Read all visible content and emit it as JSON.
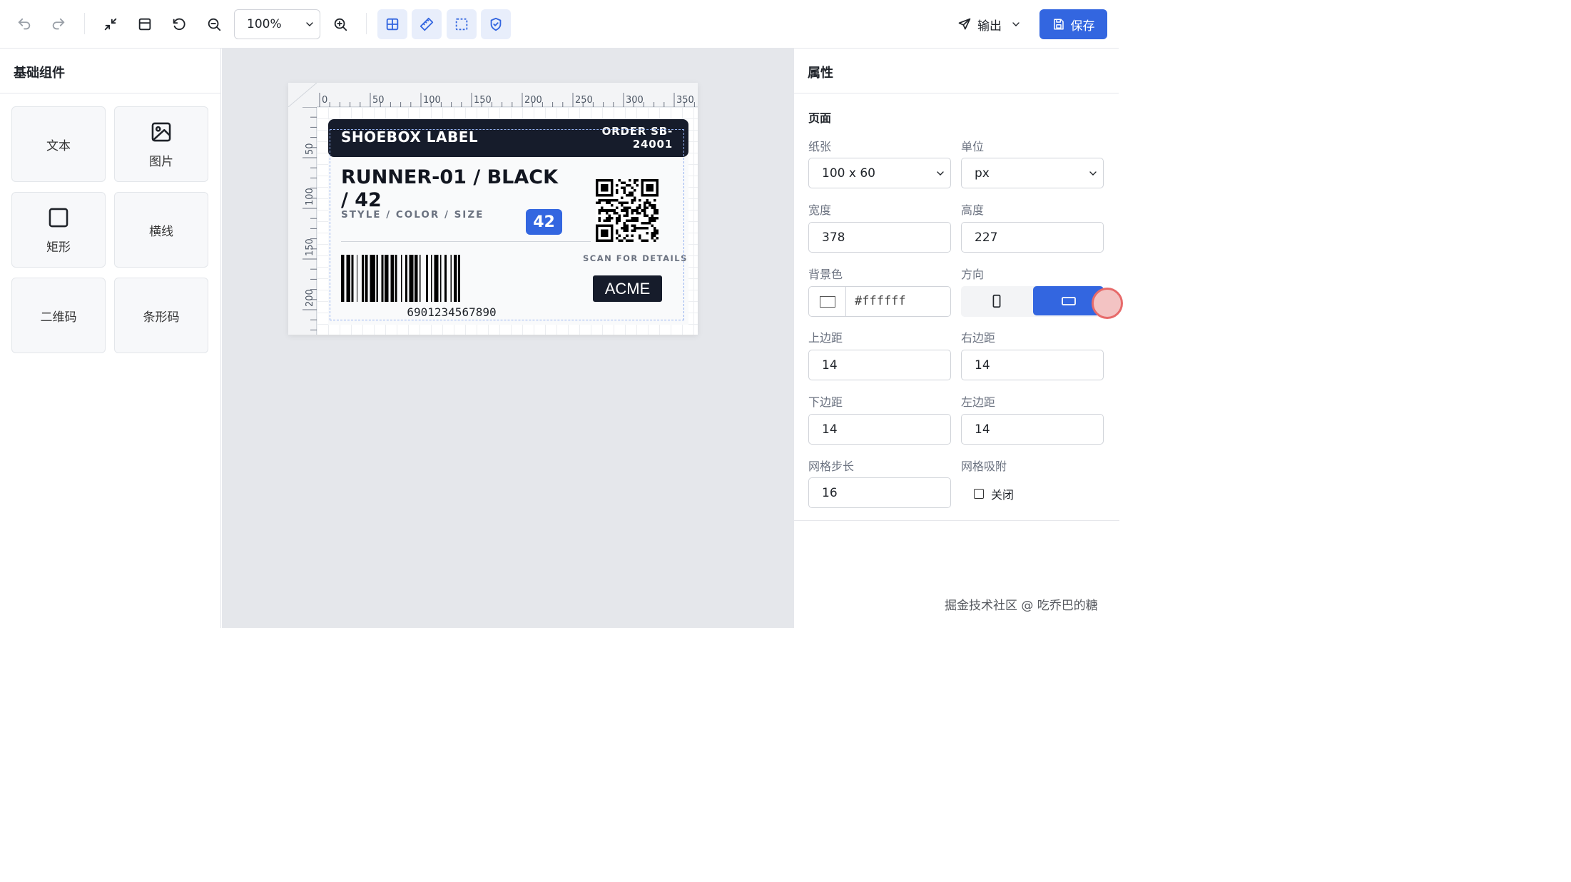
{
  "toolbar": {
    "zoom_value": "100%",
    "export_label": "输出",
    "save_label": "保存"
  },
  "left_panel": {
    "title": "基础组件",
    "components": [
      {
        "label": "文本",
        "icon": "text-icon"
      },
      {
        "label": "图片",
        "icon": "image-icon"
      },
      {
        "label": "矩形",
        "icon": "rectangle-icon"
      },
      {
        "label": "横线",
        "icon": "line-icon"
      },
      {
        "label": "二维码",
        "icon": "qrcode-icon"
      },
      {
        "label": "条形码",
        "icon": "barcode-icon"
      }
    ]
  },
  "ruler": {
    "top_labels": [
      "0",
      "50",
      "100",
      "150",
      "200",
      "250",
      "300",
      "350"
    ],
    "left_labels": [
      "50",
      "100",
      "150",
      "200"
    ]
  },
  "label": {
    "title": "SHOEBOX LABEL",
    "order_line1": "ORDER SB-",
    "order_line2": "24001",
    "product": "RUNNER-01 / BLACK / 42",
    "style_caption": "STYLE / COLOR / SIZE",
    "size_badge": "42",
    "scan_caption": "SCAN FOR DETAILS",
    "barcode_number": "6901234567890",
    "logo_text": "ACME"
  },
  "right_panel": {
    "title": "属性",
    "section": "页面",
    "paper_label": "纸张",
    "paper_value": "100 x 60",
    "unit_label": "单位",
    "unit_value": "px",
    "width_label": "宽度",
    "width_value": "378",
    "height_label": "高度",
    "height_value": "227",
    "bg_label": "背景色",
    "bg_value": "#ffffff",
    "orient_label": "方向",
    "orient_selected": "landscape",
    "margin_top_label": "上边距",
    "margin_top_value": "14",
    "margin_right_label": "右边距",
    "margin_right_value": "14",
    "margin_bottom_label": "下边距",
    "margin_bottom_value": "14",
    "margin_left_label": "左边距",
    "margin_left_value": "14",
    "grid_step_label": "网格步长",
    "grid_step_value": "16",
    "grid_snap_label": "网格吸附",
    "grid_snap_value": "关闭"
  },
  "colors": {
    "accent": "#3366e0",
    "label_dark": "#161c2b",
    "canvas_bg": "#e5e7eb"
  },
  "watermark": "掘金技术社区 @ 吃乔巴的糖"
}
